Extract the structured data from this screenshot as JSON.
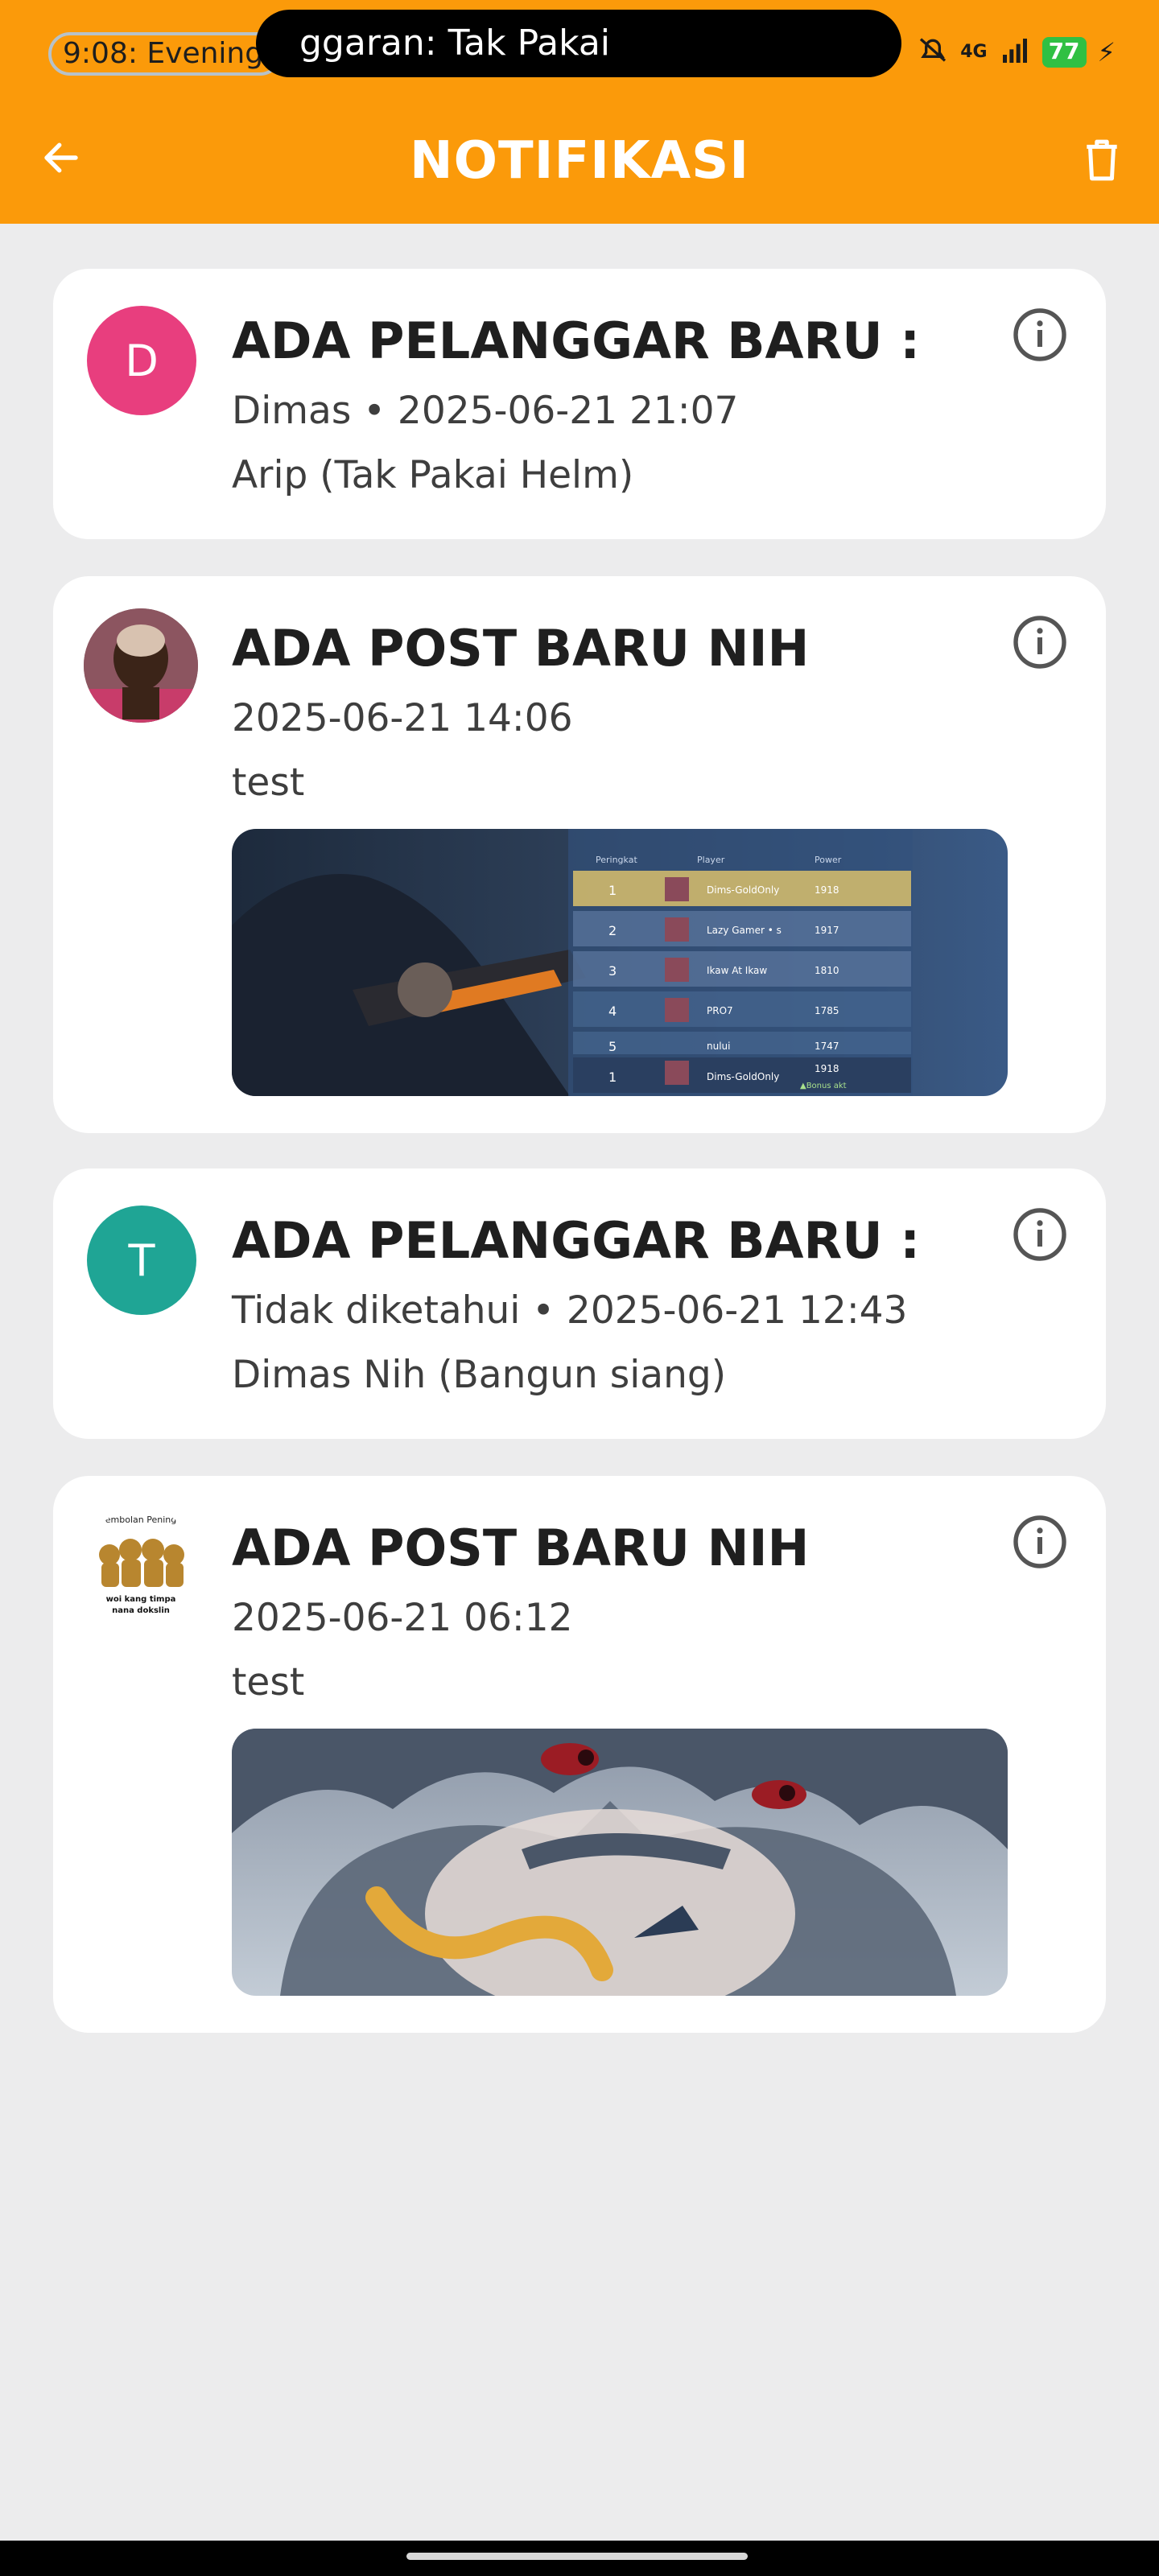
{
  "status_bar": {
    "clock_text": "9:08:  Evening",
    "ticker_text": "ggaran: Tak Pakai",
    "network": "4G",
    "battery": "77",
    "icons": [
      "no-sound-icon",
      "signal-icon",
      "battery-icon",
      "charging-icon"
    ]
  },
  "app_bar": {
    "title": "NOTIFIKASI",
    "back_icon": "arrow-left-icon",
    "delete_icon": "trash-icon",
    "background": "#fb9a0a"
  },
  "notifications": [
    {
      "title": "ADA PELANGGAR BARU :",
      "meta": "Dimas  •  2025-06-21 21:07",
      "body": "Arip (Tak Pakai Helm)",
      "avatar_letter": "D",
      "avatar_color": "#e83e7e"
    },
    {
      "title": "ADA POST BARU NIH",
      "meta": "2025-06-21 14:06",
      "body": "test",
      "image_kind": "game-leaderboard",
      "leaderboard": {
        "headers": [
          "Peringkat",
          "Player",
          "Power"
        ],
        "rows": [
          {
            "rank": "1",
            "player": "Dims-GoldOnly",
            "power": "1918"
          },
          {
            "rank": "2",
            "player": "Lazy Gamer • s",
            "power": "1917"
          },
          {
            "rank": "3",
            "player": "Ikaw At Ikaw",
            "power": "1810"
          },
          {
            "rank": "4",
            "player": "PRO7",
            "power": "1785"
          },
          {
            "rank": "5",
            "player": "nului",
            "power": "1747"
          }
        ],
        "footer": {
          "rank": "1",
          "player": "Dims-GoldOnly",
          "power": "1918",
          "note": "▲Bonus akt"
        }
      }
    },
    {
      "title": "ADA PELANGGAR BARU :",
      "meta": "Tidak diketahui  •  2025-06-21 12:43",
      "body": "Dimas Nih (Bangun siang)",
      "avatar_letter": "T",
      "avatar_color": "#1fa595"
    },
    {
      "title": "ADA POST BARU NIH",
      "meta": "2025-06-21 06:12",
      "body": "test",
      "avatar_caption_top": "embolan Pening",
      "avatar_caption_bottom": "woi kang timpa\nnana dokslin",
      "image_kind": "anime-character-crying"
    }
  ]
}
